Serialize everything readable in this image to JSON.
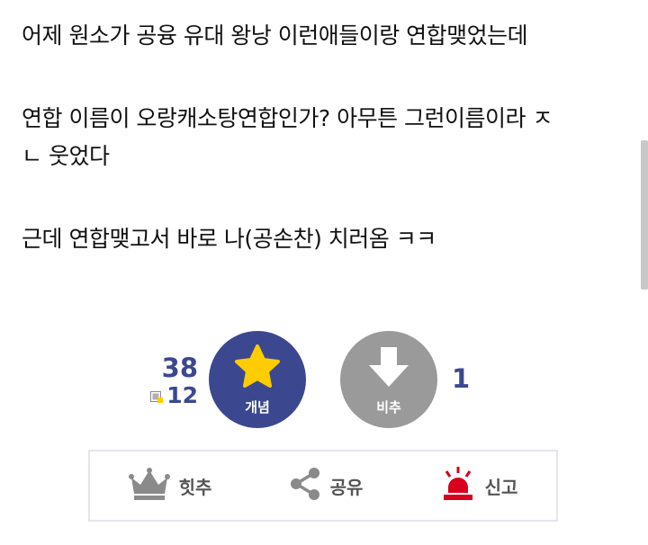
{
  "post": {
    "lines": [
      "어제 원소가 공융 유대 왕낭 이런애들이랑 연합맺었는데",
      "연합 이름이 오랑캐소탕연합인가? 아무튼 그런이름이라 ㅈ",
      "ㄴ 웃었다",
      "근데 연합맺고서 바로 나(공손찬) 치러옴 ㅋㅋ"
    ]
  },
  "votes": {
    "up_count": "38",
    "fix_count": "12",
    "up_label": "개념",
    "down_label": "비추",
    "down_count": "1"
  },
  "actions": {
    "hit_label": "힛추",
    "share_label": "공유",
    "report_label": "신고"
  },
  "colors": {
    "accent": "#3b4890",
    "star": "#ffcc00",
    "down_button": "#9a9a9a",
    "report": "#d8001c",
    "icon_gray": "#888888"
  }
}
